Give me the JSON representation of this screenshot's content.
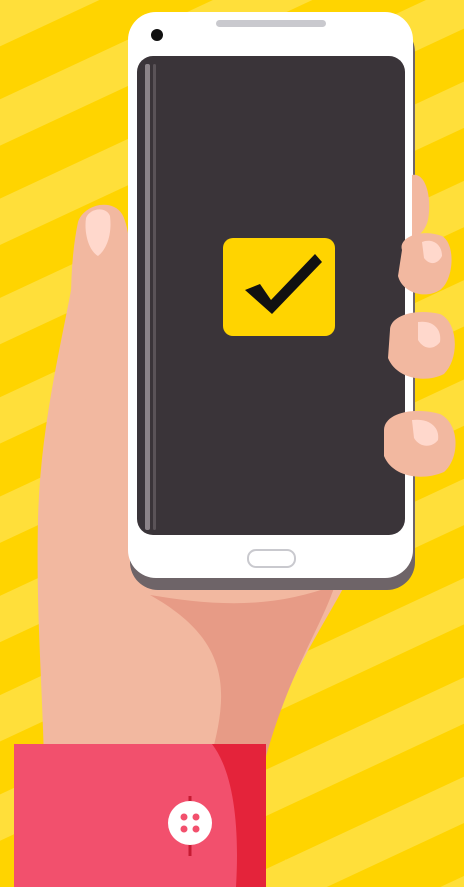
{
  "illustration": {
    "subject": "hand-holding-smartphone",
    "screen_icon": "checkmark-icon",
    "colors": {
      "background": "#FFD400",
      "background_stripe": "#FFDF3A",
      "phone_body": "#FFFFFF",
      "phone_shadow": "#6E6468",
      "phone_speaker": "#C9C9CE",
      "screen": "#3A3439",
      "screen_edge": "#8C8489",
      "check_badge": "#FFD400",
      "checkmark": "#111111",
      "skin": "#F2B8A0",
      "skin_shadow": "#E79B86",
      "nail_highlight": "#FFD8CC",
      "sleeve": "#F2506D",
      "sleeve_shadow": "#E4233A",
      "button": "#FFFFFF",
      "button_dots": "#F2506D"
    }
  }
}
